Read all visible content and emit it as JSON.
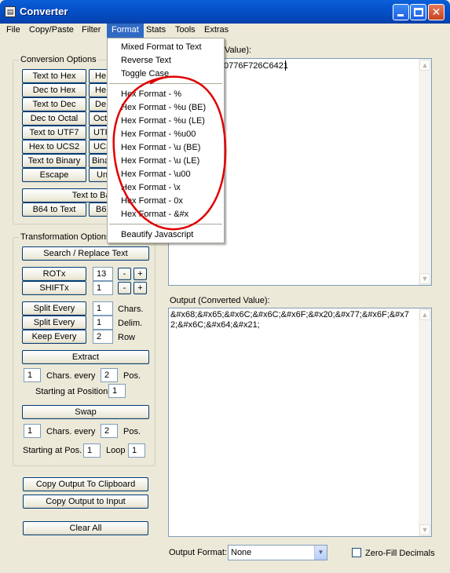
{
  "window": {
    "title": "Converter"
  },
  "menu": [
    "File",
    "Copy/Paste",
    "Filter",
    "Format",
    "Stats",
    "Tools",
    "Extras"
  ],
  "conversion": {
    "title": "Conversion Options",
    "left": [
      "Text to Hex",
      "Dec to Hex",
      "Text to Dec",
      "Dec to Octal",
      "Text to UTF7",
      "Hex to UCS2",
      "Text to Binary",
      "Escape"
    ],
    "right": [
      "He",
      "He",
      "De",
      "Oct",
      "UTF",
      "UCS",
      "Bina",
      "Un"
    ],
    "base64": "Text to Base",
    "b64left": "B64 to Text",
    "b64right": "B6"
  },
  "transform": {
    "title": "Transformation Options",
    "search_replace": "Search / Replace Text",
    "rot_label": "ROTx",
    "rot_value": "13",
    "shift_label": "SHIFTx",
    "shift_value": "1",
    "minus": "-",
    "plus": "+",
    "split_every": "Split Every",
    "split_every_value": "1",
    "chars_label": "Chars.",
    "split_every2": "Split Every",
    "split_every2_value": "1",
    "delim_label": "Delim.",
    "keep_every": "Keep Every",
    "keep_every_value": "2",
    "row_label": "Row",
    "extract": "Extract",
    "extract_chars_value": "1",
    "chars_every": "Chars. every",
    "extract_pos_value": "2",
    "pos_label": "Pos.",
    "starting_at_position": "Starting at Position",
    "start_value": "1",
    "swap": "Swap",
    "swap_chars_value": "1",
    "swap_chars_every": "Chars. every",
    "swap_pos_value": "2",
    "swap_pos_label": "Pos.",
    "starting_at_pos": "Starting at Pos.",
    "swap_start_value": "1",
    "loop_label": "Loop",
    "loop_value": "1"
  },
  "actions": {
    "copy_clipboard": "Copy Output To Clipboard",
    "copy_input": "Copy Output to Input",
    "clear_all": "Clear All"
  },
  "input": {
    "label_partial": "Value):",
    "value_partial": "0776F726C6421"
  },
  "output": {
    "label": "Output (Converted Value):",
    "value": "&#x68;&#x65;&#x6C;&#x6C;&#x6F;&#x20;&#x77;&#x6F;&#x72;&#x6C;&#x64;&#x21;"
  },
  "output_format": {
    "label": "Output Format:",
    "selected": "None"
  },
  "zero_fill": {
    "label": "Zero-Fill Decimals",
    "checked": false
  },
  "format_menu": {
    "top": [
      "Mixed Format to Text",
      "Reverse Text",
      "Toggle Case"
    ],
    "hex": [
      "Hex Format - %",
      "Hex Format - %u (BE)",
      "Hex Format - %u (LE)",
      "Hex Format - %u00",
      "Hex Format - \\u (BE)",
      "Hex Format - \\u (LE)",
      "Hex Format - \\u00",
      "Hex Format - \\x",
      "Hex Format - 0x",
      "Hex Format - &#x"
    ],
    "bottom": [
      "Beautify Javascript"
    ]
  },
  "colors": {
    "annotation": "#e00000",
    "menu_highlight": "#316ac5",
    "title_bar": "#0550c8"
  }
}
